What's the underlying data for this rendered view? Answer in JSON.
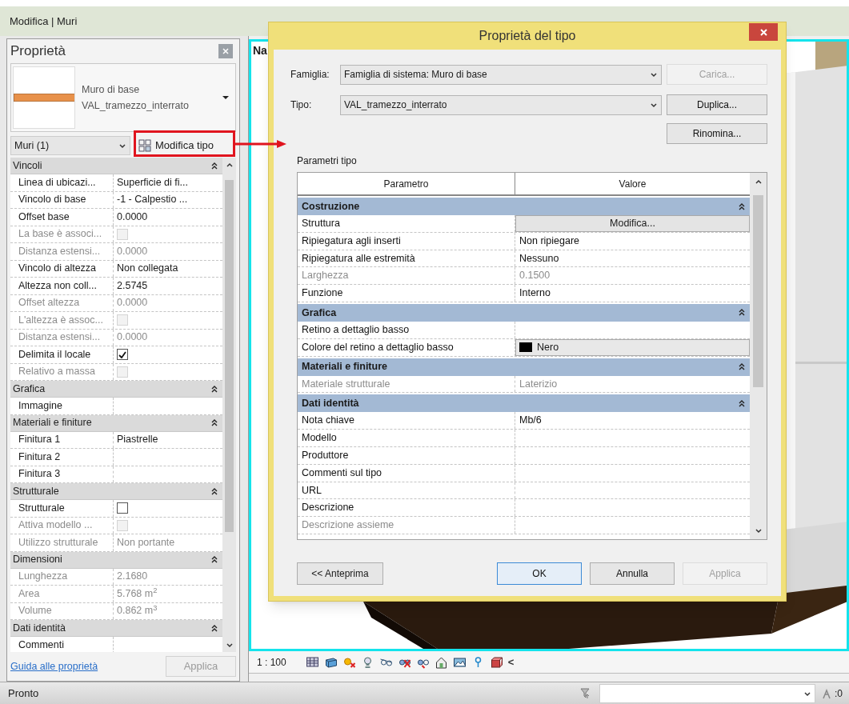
{
  "app_title": "Modifica | Muri",
  "properties": {
    "title": "Proprietà",
    "type_family": "Muro di base",
    "type_name": "VAL_tramezzo_interrato",
    "filter": "Muri (1)",
    "edit_type_button": "Modifica tipo",
    "sections": [
      {
        "name": "Vincoli",
        "expanded": true,
        "rows": [
          {
            "label": "Linea di ubicazi...",
            "kind": "text",
            "value": "Superficie di fi...",
            "disabled": false
          },
          {
            "label": "Vincolo di base",
            "kind": "text",
            "value": "-1 - Calpestio ...",
            "disabled": false
          },
          {
            "label": "Offset base",
            "kind": "text",
            "value": "0.0000",
            "disabled": false
          },
          {
            "label": "La base è associ...",
            "kind": "checkbox",
            "checked": false,
            "disabled": true
          },
          {
            "label": "Distanza estensi...",
            "kind": "text",
            "value": "0.0000",
            "disabled": true
          },
          {
            "label": "Vincolo di altezza",
            "kind": "text",
            "value": "Non collegata",
            "disabled": false
          },
          {
            "label": "Altezza non coll...",
            "kind": "text",
            "value": "2.5745",
            "disabled": false
          },
          {
            "label": "Offset altezza",
            "kind": "text",
            "value": "0.0000",
            "disabled": true
          },
          {
            "label": "L'altezza è assoc...",
            "kind": "checkbox",
            "checked": false,
            "disabled": true
          },
          {
            "label": "Distanza estensi...",
            "kind": "text",
            "value": "0.0000",
            "disabled": true
          },
          {
            "label": "Delimita il locale",
            "kind": "checkbox",
            "checked": true,
            "disabled": false
          },
          {
            "label": "Relativo a massa",
            "kind": "checkbox",
            "checked": false,
            "disabled": true
          }
        ]
      },
      {
        "name": "Grafica",
        "expanded": true,
        "rows": [
          {
            "label": "Immagine",
            "kind": "text",
            "disabled": false
          }
        ]
      },
      {
        "name": "Materiali e finiture",
        "expanded": true,
        "rows": [
          {
            "label": "Finitura 1",
            "kind": "text",
            "value": "Piastrelle",
            "disabled": false
          },
          {
            "label": "Finitura 2",
            "kind": "text",
            "disabled": false
          },
          {
            "label": "Finitura 3",
            "kind": "text",
            "disabled": false
          }
        ]
      },
      {
        "name": "Strutturale",
        "expanded": true,
        "rows": [
          {
            "label": "Strutturale",
            "kind": "checkbox",
            "checked": false,
            "disabled": false
          },
          {
            "label": "Attiva modello ...",
            "kind": "checkbox",
            "checked": false,
            "disabled": true
          },
          {
            "label": "Utilizzo strutturale",
            "kind": "text",
            "value": "Non portante",
            "disabled": true
          }
        ]
      },
      {
        "name": "Dimensioni",
        "expanded": true,
        "rows": [
          {
            "label": "Lunghezza",
            "kind": "text",
            "value": "2.1680",
            "disabled": true
          },
          {
            "label": "Area",
            "kind": "text",
            "value": "5.768 m$^{2}$",
            "disabled": true
          },
          {
            "label": "Volume",
            "kind": "text",
            "value": "0.862 m$^{3}$",
            "disabled": true
          }
        ]
      },
      {
        "name": "Dati identità",
        "expanded": true,
        "rows": [
          {
            "label": "Commenti",
            "kind": "text",
            "disabled": false
          }
        ]
      }
    ],
    "help_link": "Guida alle proprietà",
    "apply_button": {
      "label": "Applica",
      "disabled": true
    }
  },
  "viewport": {
    "title": "Na",
    "scale": "1 : 100",
    "toolbar_more": "<"
  },
  "dialog": {
    "title": "Proprietà del tipo",
    "family": {
      "label": "Famiglia:",
      "value": "Famiglia di sistema: Muro di base"
    },
    "type": {
      "label": "Tipo:",
      "value": "VAL_tramezzo_interrato"
    },
    "side_buttons": [
      {
        "label": "Carica...",
        "disabled": true
      },
      {
        "label": "Duplica...",
        "disabled": false
      },
      {
        "label": "Rinomina...",
        "disabled": false
      }
    ],
    "params_label": "Parametri tipo",
    "columns": [
      "Parametro",
      "Valore"
    ],
    "sections": [
      {
        "name": "Costruzione",
        "expanded": true,
        "rows": [
          {
            "label": "Struttura",
            "kind": "button",
            "value": "Modifica...",
            "disabled": false
          },
          {
            "label": "Ripiegatura agli inserti",
            "kind": "text",
            "value": "Non ripiegare",
            "disabled": false
          },
          {
            "label": "Ripiegatura alle estremità",
            "kind": "text",
            "value": "Nessuno",
            "disabled": false
          },
          {
            "label": "Larghezza",
            "kind": "text",
            "value": "0.1500",
            "disabled": true
          },
          {
            "label": "Funzione",
            "kind": "text",
            "value": "Interno",
            "disabled": false
          }
        ]
      },
      {
        "name": "Grafica",
        "expanded": true,
        "rows": [
          {
            "label": "Retino a dettaglio basso",
            "kind": "text",
            "disabled": false
          },
          {
            "label": "Colore del retino a dettaglio basso",
            "kind": "color",
            "value": "Nero",
            "color": "#000000",
            "disabled": false
          }
        ]
      },
      {
        "name": "Materiali e finiture",
        "expanded": true,
        "rows": [
          {
            "label": "Materiale strutturale",
            "kind": "text",
            "value": "Laterizio",
            "disabled": true
          }
        ]
      },
      {
        "name": "Dati identità",
        "expanded": true,
        "rows": [
          {
            "label": "Nota chiave",
            "kind": "text",
            "value": "Mb/6",
            "disabled": false
          },
          {
            "label": "Modello",
            "kind": "text",
            "disabled": false
          },
          {
            "label": "Produttore",
            "kind": "text",
            "disabled": false
          },
          {
            "label": "Commenti sul tipo",
            "kind": "text",
            "disabled": false
          },
          {
            "label": "URL",
            "kind": "text",
            "disabled": false
          },
          {
            "label": "Descrizione",
            "kind": "text",
            "disabled": false
          },
          {
            "label": "Descrizione assieme",
            "kind": "text",
            "disabled": true
          }
        ]
      }
    ],
    "preview_button": "<< Anteprima",
    "buttons": [
      {
        "label": "OK",
        "default": true,
        "disabled": false
      },
      {
        "label": "Annulla",
        "default": false,
        "disabled": false
      },
      {
        "label": "Applica",
        "default": false,
        "disabled": true
      }
    ]
  },
  "status_bar": {
    "text": "Pronto",
    "counter": ":0"
  }
}
